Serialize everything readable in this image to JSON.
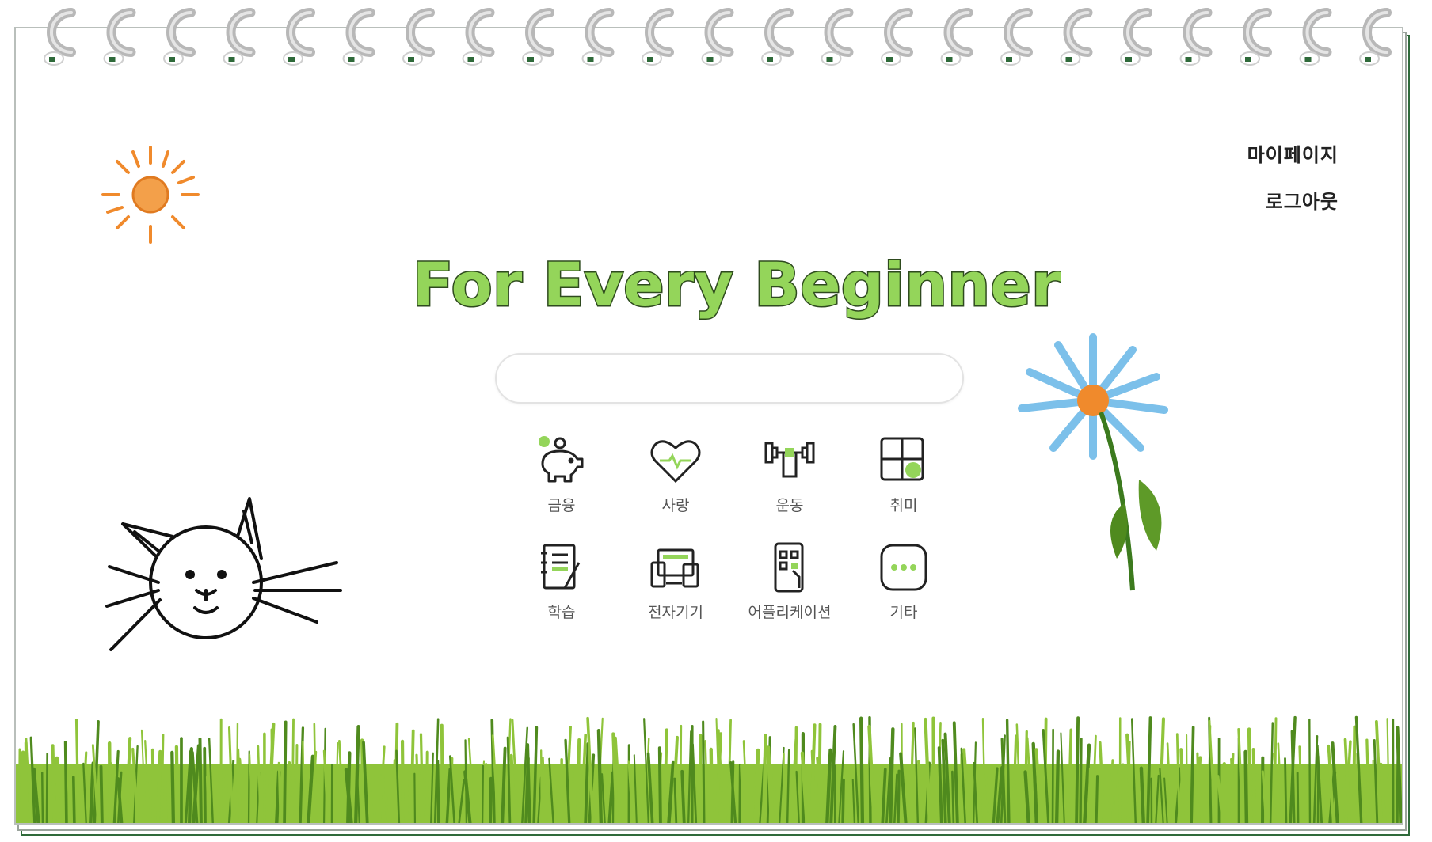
{
  "title": "For Every Beginner",
  "nav": {
    "mypage": "마이페이지",
    "logout": "로그아웃"
  },
  "search": {
    "value": "",
    "placeholder": ""
  },
  "categories": [
    {
      "label": "금융",
      "icon": "piggy-bank-icon"
    },
    {
      "label": "사랑",
      "icon": "heart-icon"
    },
    {
      "label": "운동",
      "icon": "dumbbell-icon"
    },
    {
      "label": "취미",
      "icon": "puzzle-icon"
    },
    {
      "label": "학습",
      "icon": "notebook-icon"
    },
    {
      "label": "전자기기",
      "icon": "devices-icon"
    },
    {
      "label": "어플리케이션",
      "icon": "mobile-app-icon"
    },
    {
      "label": "기타",
      "icon": "more-icon"
    }
  ],
  "colors": {
    "title_fill": "#94d55a",
    "title_outline": "#2e4a1e",
    "grass_dark": "#4f8a1e",
    "grass_light": "#8fc43a",
    "sun": "#f08a2c",
    "petal": "#7cc0ea",
    "stem": "#3c7a1e"
  }
}
